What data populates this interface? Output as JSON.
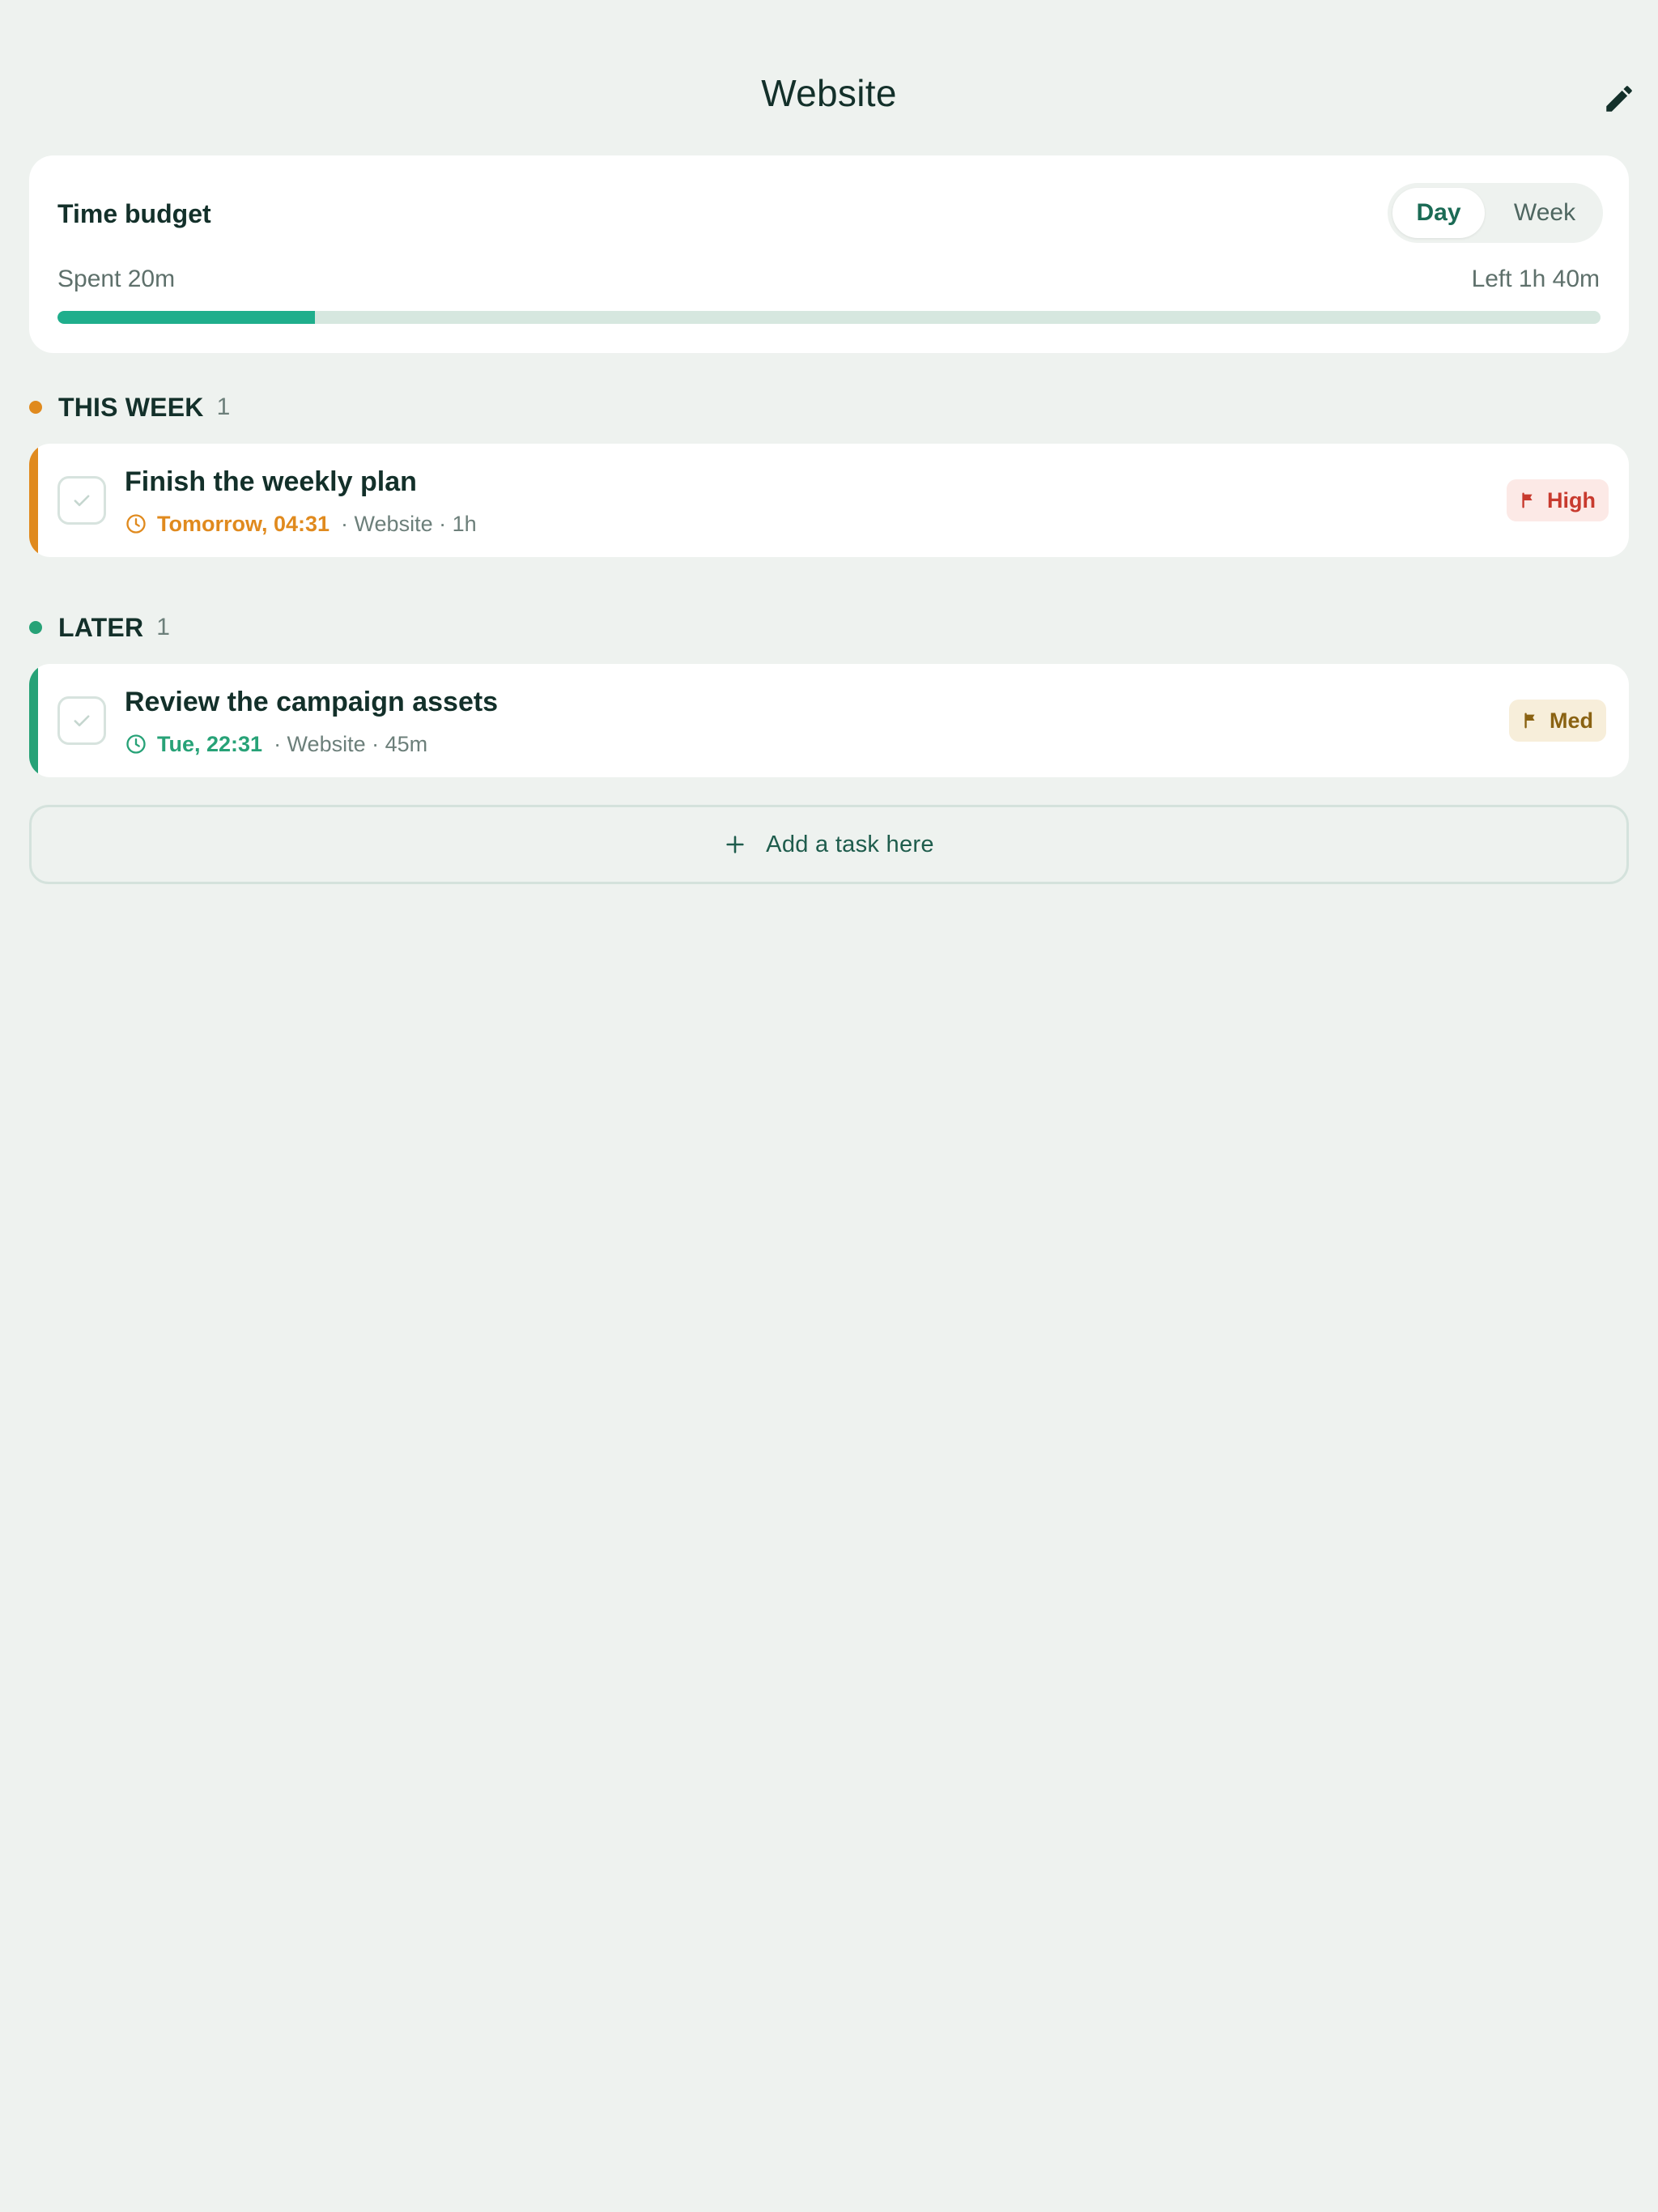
{
  "header": {
    "title": "Website",
    "edit_icon": "pencil-icon"
  },
  "budget": {
    "title": "Time budget",
    "toggle": {
      "options": [
        "Day",
        "Week"
      ],
      "selected": "Day"
    },
    "spent_label": "Spent 20m",
    "left_label": "Left 1h 40m",
    "progress_fraction": 0.1667,
    "colors": {
      "fill": "#1FAE8C",
      "track": "#D6E7DF"
    }
  },
  "sections": [
    {
      "label": "THIS WEEK",
      "count": "1",
      "color": "#E08A1E",
      "tasks": [
        {
          "title": "Finish the weekly plan",
          "due": "Tomorrow, 04:31",
          "due_color": "#E08A1E",
          "meta": "· Website · 1h",
          "priority": "High",
          "priority_fg": "#C83A2E",
          "priority_bg": "#FCE9E6",
          "icons": [
            "check-icon",
            "clock-icon",
            "flag-icon"
          ]
        }
      ]
    },
    {
      "label": "LATER",
      "count": "1",
      "color": "#27A277",
      "tasks": [
        {
          "title": "Review the campaign assets",
          "due": "Tue, 22:31",
          "due_color": "#27A277",
          "meta": "· Website · 45m",
          "priority": "Med",
          "priority_fg": "#8A6212",
          "priority_bg": "#F7EEDA",
          "icons": [
            "check-icon",
            "clock-icon",
            "flag-icon"
          ]
        }
      ]
    }
  ],
  "add_task": {
    "label": "Add a task here",
    "icon": "plus-icon"
  }
}
